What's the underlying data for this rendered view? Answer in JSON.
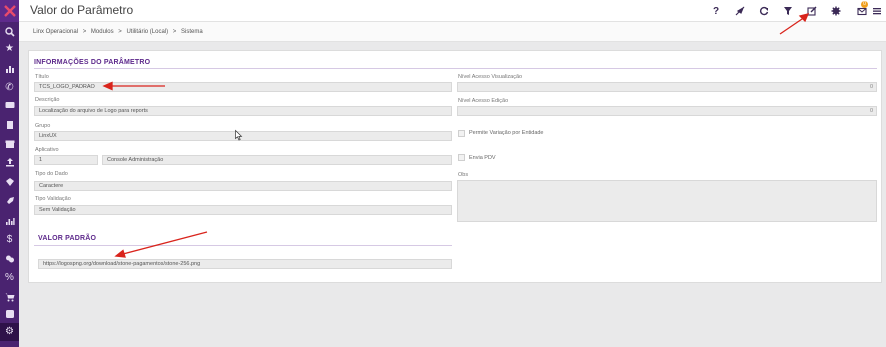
{
  "header": {
    "title": "Valor do Parâmetro",
    "help_label": "?"
  },
  "breadcrumb": [
    "Linx Operacional",
    ">",
    "Modulos",
    ">",
    "Utilitário (Local)",
    ">",
    "Sistema"
  ],
  "notification_count": "0",
  "section_info": {
    "title": "INFORMAÇÕES DO PARÂMETRO"
  },
  "fields": {
    "titulo": {
      "label": "Título",
      "value": "TCS_LOGO_PADRAO"
    },
    "descricao": {
      "label": "Descrição",
      "value": "Localização do arquivo de Logo para reports"
    },
    "grupo": {
      "label": "Grupo",
      "value": "LinxUX"
    },
    "aplicativo": {
      "label": "Aplicativo",
      "code": "1",
      "name": "Console Administração"
    },
    "tipo_dado": {
      "label": "Tipo do Dado",
      "value": "Caractere"
    },
    "tipo_validacao": {
      "label": "Tipo Validação",
      "value": "Sem Validação"
    },
    "nivel_visualizacao": {
      "label": "Nível Acesso Visualização",
      "value": "0"
    },
    "nivel_edicao": {
      "label": "Nível Acesso Edição",
      "value": "0"
    },
    "permite_variacao": {
      "label": "Permite Variação por Entidade",
      "checked": false
    },
    "envia_pdv": {
      "label": "Envia PDV",
      "checked": false
    },
    "obs": {
      "label": "Obs",
      "value": ""
    }
  },
  "section_valor": {
    "title": "VALOR PADRÃO"
  },
  "valor_padrao": {
    "value": "https://logospng.org/download/stone-pagamentos/stone-256.png"
  },
  "colors": {
    "sidebar": "#4a2370",
    "accent": "#5e2a8c",
    "annotation": "#d9241c"
  }
}
